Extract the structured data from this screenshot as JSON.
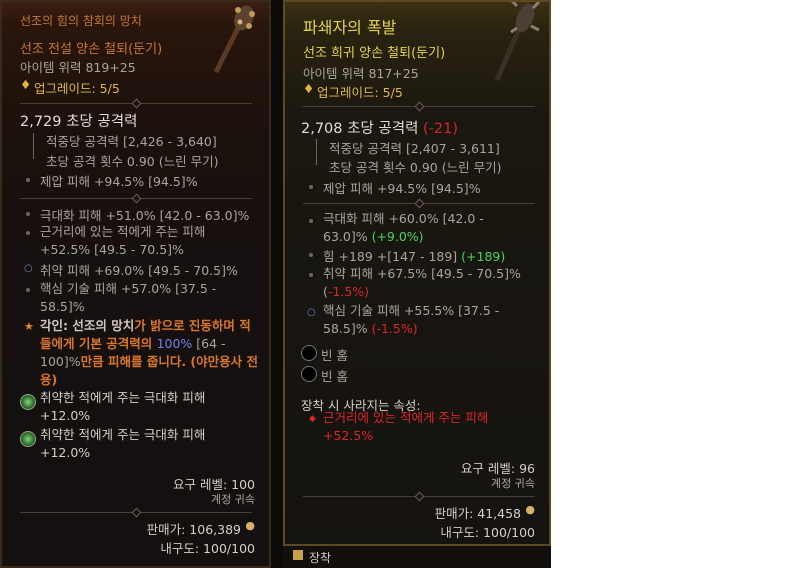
{
  "left": {
    "title": "선조의 힘의 참회의 망치",
    "subtitle": "선조 전설 양손 철퇴(둔기)",
    "item_power": "아이템 위력 819+25",
    "upgrades": "업그레이드: 5/5",
    "dps": "2,729 초당 공격력",
    "hit_damage": "적중당 공격력 [2,426 - 3,640]",
    "attack_speed": "초당 공격 횟수 0.90 (느린 무기)",
    "implicit": "제압 피해 +94.5% [94.5]%",
    "affixes": [
      "극대화 피해 +51.0% [42.0 - 63.0]%",
      "근거리에 있는 적에게 주는 피해 +52.5% [49.5 - 70.5]%",
      "취약 피해 +69.0% [49.5 - 70.5]%",
      "핵심 기술 피해 +57.0% [37.5 - 58.5]%"
    ],
    "aspect_label": "각인: ",
    "aspect_name": "선조의 망치",
    "aspect_text1": "가 밝으로 진동하며 적들에게 기본 공격력의 ",
    "aspect_value": "100%",
    "aspect_range": " [64 - 100]%",
    "aspect_text2": "만큼 피해를 줍니다. (야만용사 전용)",
    "gems": [
      "취약한 적에게 주는 극대화 피해 +12.0%",
      "취약한 적에게 주는 극대화 피해 +12.0%"
    ],
    "required_level": "요구 레벨: 100",
    "account_bound": "계정 귀속",
    "sell_value": "판매가: 106,389",
    "durability": "내구도: 100/100"
  },
  "right": {
    "title": "파쇄자의 폭발",
    "subtitle": "선조 희귀 양손 철퇴(둔기)",
    "item_power": "아이템 위력 817+25",
    "upgrades": "업그레이드: 5/5",
    "dps": "2,708 초당 공격력",
    "dps_diff": "(-21)",
    "hit_damage": "적중당 공격력 [2,407 - 3,611]",
    "attack_speed": "초당 공격 횟수 0.90 (느린 무기)",
    "implicit": "제압 피해 +94.5% [94.5]%",
    "affix1": "극대화 피해 +60.0% [42.0 - 63.0]%",
    "affix1_diff": "(+9.0%)",
    "affix2": "힘 +189 +[147 - 189]",
    "affix2_diff": "(+189)",
    "affix3": "취약 피해 +67.5% [49.5 - 70.5]% (",
    "affix3_diff": "-1.5%)",
    "affix4": "핵심 기술 피해 +55.5% [37.5 - 58.5]%",
    "affix4_diff": "(-1.5%)",
    "sockets": [
      "빈 홈",
      "빈 홈"
    ],
    "lost_header": "장착 시 사라지는 속성:",
    "lost_affix": "근거리에 있는 적에게 주는 피해 +52.5%",
    "required_level": "요구 레벨: 96",
    "account_bound": "계정 귀속",
    "sell_value": "판매가: 41,458",
    "durability": "내구도: 100/100"
  },
  "bottom_label": "장착",
  "colors": {
    "legendary": "#c67735",
    "rare": "#e3d34a",
    "decrease": "#d8252a",
    "increase": "#4ad15b"
  }
}
